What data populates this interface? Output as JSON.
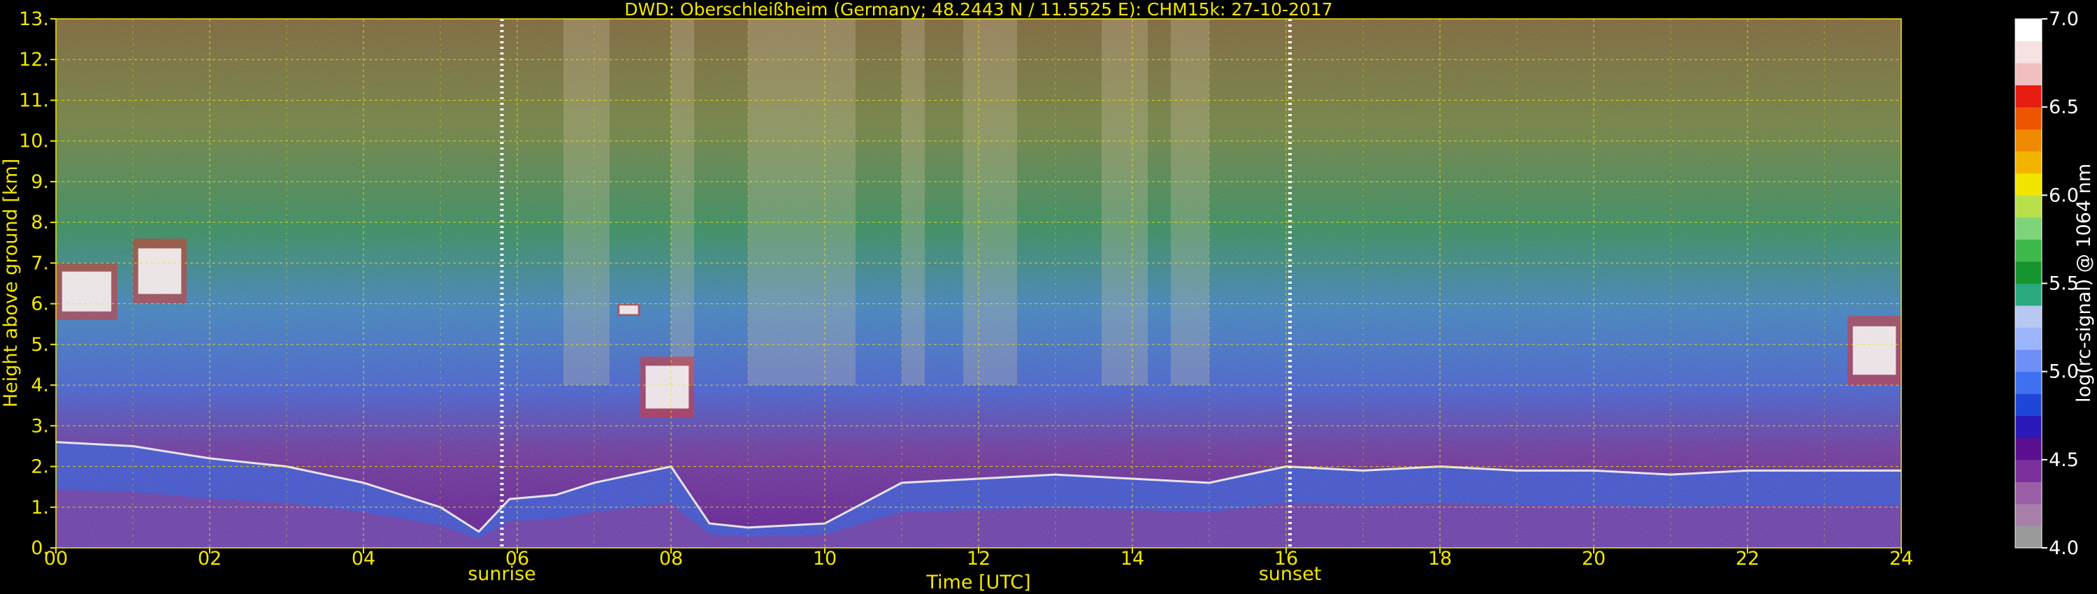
{
  "chart_data": {
    "type": "heatmap",
    "title": "DWD: Oberschleißheim (Germany; 48.2443 N / 11.5525 E):    CHM15k: 27-10-2017",
    "xlabel": "Time [UTC]",
    "ylabel": "Height above ground [km]",
    "xlim": [
      0,
      24
    ],
    "ylim": [
      0,
      13
    ],
    "x_ticks": [
      "00",
      "02",
      "04",
      "06",
      "08",
      "10",
      "12",
      "14",
      "16",
      "18",
      "20",
      "22",
      "24"
    ],
    "y_ticks": [
      "0.",
      "1.",
      "2.",
      "3.",
      "4.",
      "5.",
      "6.",
      "7.",
      "8.",
      "9.",
      "10.",
      "11.",
      "12.",
      "13."
    ],
    "grid": true,
    "annotations": [
      {
        "label": "sunrise",
        "time": 5.8
      },
      {
        "label": "sunset",
        "time": 16.05
      }
    ],
    "colorbar": {
      "label": "log(rc-signal) @ 1064 nm",
      "range": [
        4.0,
        7.0
      ],
      "ticks": [
        "4.0",
        "4.5",
        "5.0",
        "5.5",
        "6.0",
        "6.5",
        "7.0"
      ],
      "colors": [
        "#9a9a9a",
        "#a77fa8",
        "#9a5fa6",
        "#7a2f9a",
        "#5a1090",
        "#2a18b8",
        "#2046d8",
        "#3f70f0",
        "#6f8ff8",
        "#9db4ff",
        "#b9c8f0",
        "#2aa87e",
        "#16952f",
        "#3eb84a",
        "#7fd47a",
        "#b8e04a",
        "#f2e600",
        "#f3b400",
        "#f08a00",
        "#ee5500",
        "#e81c10",
        "#f0bfbf",
        "#f6e2e2",
        "#ffffff"
      ]
    },
    "layers": [
      {
        "name": "boundary-layer",
        "t": [
          0,
          1,
          2,
          3,
          4,
          5,
          5.5,
          5.9,
          6.5,
          7,
          8,
          8.5,
          9,
          10,
          11,
          12,
          13,
          14,
          15,
          16,
          17,
          18,
          19,
          20,
          21,
          22,
          23,
          24
        ],
        "top_km": [
          2.6,
          2.5,
          2.2,
          2.0,
          1.6,
          1.0,
          0.4,
          1.2,
          1.3,
          1.6,
          2.0,
          0.6,
          0.5,
          0.6,
          1.6,
          1.7,
          1.8,
          1.7,
          1.6,
          2.0,
          1.9,
          2.0,
          1.9,
          1.9,
          1.8,
          1.9,
          1.9,
          1.9
        ]
      },
      {
        "name": "cloud",
        "t_start": 0.0,
        "t_end": 0.8,
        "base_km": 5.6,
        "top_km": 7.0
      },
      {
        "name": "cloud",
        "t_start": 1.0,
        "t_end": 1.7,
        "base_km": 6.0,
        "top_km": 7.6
      },
      {
        "name": "cloud",
        "t_start": 7.6,
        "t_end": 8.3,
        "base_km": 3.2,
        "top_km": 4.7
      },
      {
        "name": "cloud",
        "t_start": 7.3,
        "t_end": 7.6,
        "base_km": 5.7,
        "top_km": 6.0
      },
      {
        "name": "cloud",
        "t_start": 23.3,
        "t_end": 24.0,
        "base_km": 4.0,
        "top_km": 5.7
      }
    ]
  }
}
